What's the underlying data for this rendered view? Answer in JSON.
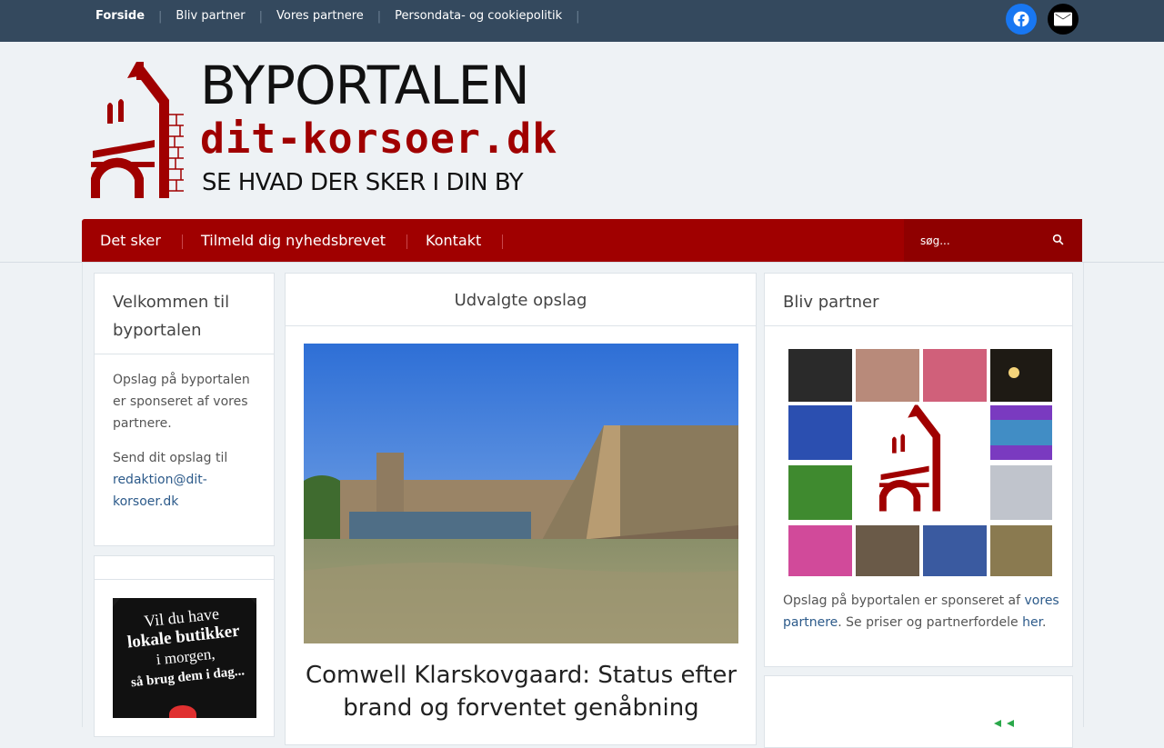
{
  "topnav": {
    "items": [
      "Forside",
      "Bliv partner",
      "Vores partnere",
      "Persondata- og cookiepolitik"
    ]
  },
  "social": {
    "icons": [
      "facebook-icon",
      "email-icon"
    ]
  },
  "logo": {
    "line1": "BYPORTALEN",
    "line2": "dit-korsoer.dk",
    "line3": "SE HVAD DER SKER I DIN BY"
  },
  "mainnav": {
    "items": [
      "Det sker",
      "Tilmeld dig nyhedsbrevet",
      "Kontakt"
    ],
    "search_placeholder": "søg..."
  },
  "left_widget": {
    "title": "Velkommen til byportalen",
    "para1": "Opslag på byportalen er sponseret af vores partnere.",
    "para2_prefix": "Send dit opslag til ",
    "email": "redaktion@dit-korsoer.dk"
  },
  "left_widget2": {
    "sign_line1": "Vil du have",
    "sign_line2": "lokale butikker",
    "sign_line3": "i morgen,",
    "sign_line4": "så brug dem i dag..."
  },
  "center_widget": {
    "title": "Udvalgte opslag",
    "headline": "Comwell Klarskovgaard: Status efter brand og forventet genåbning"
  },
  "right_widget": {
    "title": "Bliv partner",
    "text_prefix": "Opslag på byportalen er sponseret af ",
    "link1": "vores partnere",
    "text_mid": ". Se priser og partnerfordele ",
    "link2": "her",
    "text_suffix": "."
  },
  "colors": {
    "topbar": "#34495e",
    "brand_red": "#a00000",
    "link": "#2c5a8a",
    "page_bg": "#eef2f5"
  }
}
